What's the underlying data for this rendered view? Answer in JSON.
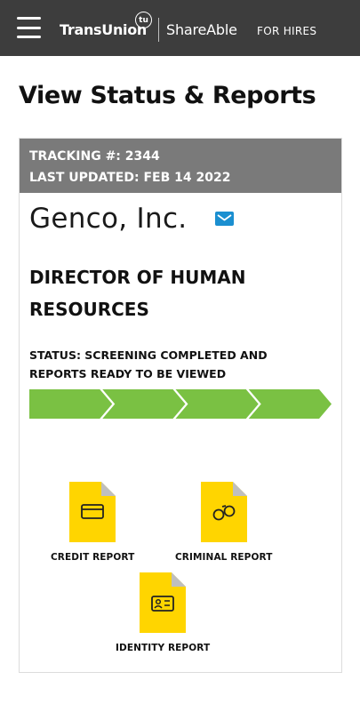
{
  "header": {
    "brand": "TransUnion",
    "brand_badge": "tu",
    "product": "ShareAble",
    "audience": "FOR HIRES",
    "menu_icon": "hamburger-menu-icon",
    "background": "#3d3d3d"
  },
  "page": {
    "title": "View Status & Reports"
  },
  "card": {
    "tracking": "TRACKING #: 2344",
    "last_updated": "LAST UPDATED: FEB 14 2022",
    "company": "Genco, Inc.",
    "mail_icon": "envelope-icon",
    "job_title": "DIRECTOR OF HUMAN RESOURCES",
    "status": "STATUS: SCREENING COMPLETED AND REPORTS READY TO BE VIEWED",
    "progress": {
      "steps_completed": 4,
      "steps_total": 4,
      "color": "#7ac143"
    }
  },
  "reports": [
    {
      "label": "CREDIT REPORT",
      "icon": "credit-card-icon"
    },
    {
      "label": "CRIMINAL REPORT",
      "icon": "handcuffs-icon"
    },
    {
      "label": "IDENTITY REPORT",
      "icon": "id-card-icon"
    }
  ],
  "colors": {
    "header_bar": "#3d3d3d",
    "card_header": "#7a7a7a",
    "progress_green": "#7ac143",
    "document_yellow": "#ffd500",
    "mail_blue": "#1b8fd0"
  }
}
